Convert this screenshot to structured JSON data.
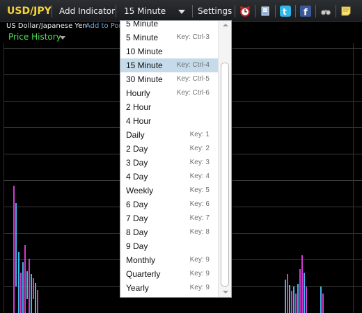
{
  "toolbar": {
    "symbol": "USD/JPY",
    "add_indicator": "Add Indicator",
    "interval_value": "15 Minute",
    "settings": "Settings",
    "icons": [
      "alarm-clock-icon",
      "book-icon",
      "twitter-icon",
      "facebook-icon",
      "binoculars-icon",
      "sticky-note-icon"
    ]
  },
  "subheader": {
    "instrument_name": "US Dollar/Japanese Yen",
    "add_to_portfolio": "Add to Por",
    "price_history": "Price History"
  },
  "interval_menu": {
    "selected": "15 Minute",
    "items": [
      {
        "label": "5 Minute",
        "key": ""
      },
      {
        "label": "5 Minute",
        "key": "Key: Ctrl-3"
      },
      {
        "label": "10 Minute",
        "key": ""
      },
      {
        "label": "15 Minute",
        "key": "Key: Ctrl-4"
      },
      {
        "label": "30 Minute",
        "key": "Key: Ctrl-5"
      },
      {
        "label": "Hourly",
        "key": "Key: Ctrl-6"
      },
      {
        "label": "2 Hour",
        "key": ""
      },
      {
        "label": "4 Hour",
        "key": ""
      },
      {
        "label": "Daily",
        "key": "Key: 1"
      },
      {
        "label": "2 Day",
        "key": "Key: 2"
      },
      {
        "label": "3 Day",
        "key": "Key: 3"
      },
      {
        "label": "4 Day",
        "key": "Key: 4"
      },
      {
        "label": "Weekly",
        "key": "Key: 5"
      },
      {
        "label": "6 Day",
        "key": "Key: 6"
      },
      {
        "label": "7 Day",
        "key": "Key: 7"
      },
      {
        "label": "8 Day",
        "key": "Key: 8"
      },
      {
        "label": "9 Day",
        "key": ""
      },
      {
        "label": "Monthly",
        "key": "Key: 9"
      },
      {
        "label": "Quarterly",
        "key": "Key: 9"
      },
      {
        "label": "Yearly",
        "key": "Key: 9"
      }
    ]
  },
  "colors": {
    "symbol": "#f5d43a",
    "price_history": "#4fe04f",
    "link": "#6fa6e8",
    "selected_item": "#c5dbea",
    "candle_up": "#3fb7e8",
    "candle_down": "#d03ad0"
  }
}
